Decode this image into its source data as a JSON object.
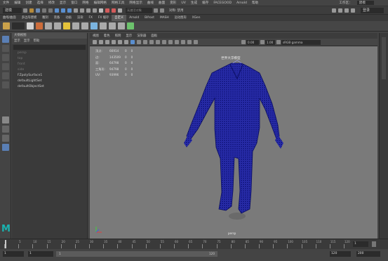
{
  "menubar": {
    "items": [
      "文件",
      "编辑",
      "创建",
      "选择",
      "修改",
      "显示",
      "窗口",
      "网格",
      "编辑网格",
      "网格工具",
      "网格显示",
      "曲线",
      "曲面",
      "变形",
      "UV",
      "生成",
      "缓存",
      "FACEGOOD",
      "Arnold",
      "帮助"
    ],
    "workspace_label": "工作区：",
    "workspace_value": "建模"
  },
  "statusbar": {
    "mode_value": "建模",
    "target_placeholder": "无激活对象",
    "symmetry_label": "对称: 禁用",
    "user_label": "登录"
  },
  "shelftabs": [
    "曲线/曲面",
    "多边形建模",
    "雕刻",
    "装备",
    "动画",
    "渲染",
    "FX",
    "FX 缓存",
    "自定义",
    "Arnold",
    "Bifrost",
    "MASH",
    "运动图形",
    "XGen"
  ],
  "shelf_active": "自定义",
  "outliner": {
    "title": "大纲视图",
    "menu": [
      "显示",
      "显示",
      "帮助"
    ],
    "search_placeholder": "搜索...",
    "items": [
      {
        "label": "persp",
        "dim": true
      },
      {
        "label": "top",
        "dim": true
      },
      {
        "label": "front",
        "dim": true
      },
      {
        "label": "side",
        "dim": true
      },
      {
        "label": "FZpolySurface1",
        "dim": false
      },
      {
        "label": "defaultLightSet",
        "dim": false
      },
      {
        "label": "defaultObjectSet",
        "dim": false
      }
    ]
  },
  "viewport": {
    "menu": [
      "视图",
      "着色",
      "照明",
      "显示",
      "渲染器",
      "面板"
    ],
    "exposure": "0.00",
    "gamma": "1.00",
    "colorspace": "sRGB gamma",
    "camera_title": "世界大浮模型",
    "camera_name": "persp",
    "hud": [
      {
        "label": "顶点:",
        "v1": "66914",
        "v2": "0",
        "v3": "0"
      },
      {
        "label": "边:",
        "v1": "143509",
        "v2": "0",
        "v3": "0"
      },
      {
        "label": "面:",
        "v1": "64798",
        "v2": "0",
        "v3": "0"
      },
      {
        "label": "三角形:",
        "v1": "94798",
        "v2": "0",
        "v3": "0"
      },
      {
        "label": "UV:",
        "v1": "93996",
        "v2": "0",
        "v3": "0"
      }
    ]
  },
  "timeline": {
    "ticks": [
      "1",
      "5",
      "10",
      "15",
      "20",
      "25",
      "30",
      "35",
      "40",
      "45",
      "50",
      "55",
      "60",
      "65",
      "70",
      "75",
      "80",
      "85",
      "90",
      "95",
      "100",
      "105",
      "110",
      "115",
      "120"
    ],
    "current_frame": "1"
  },
  "range": {
    "start": "1",
    "playback_start": "1",
    "range_end_inner": "120",
    "playback_end": "120",
    "end": "200",
    "range_value_start": "1",
    "range_value_end": "120"
  },
  "colors": {
    "wireframe": "#1e22a8",
    "viewport_bg": "#7a7a7a",
    "maya_logo": "#19b3b0"
  }
}
